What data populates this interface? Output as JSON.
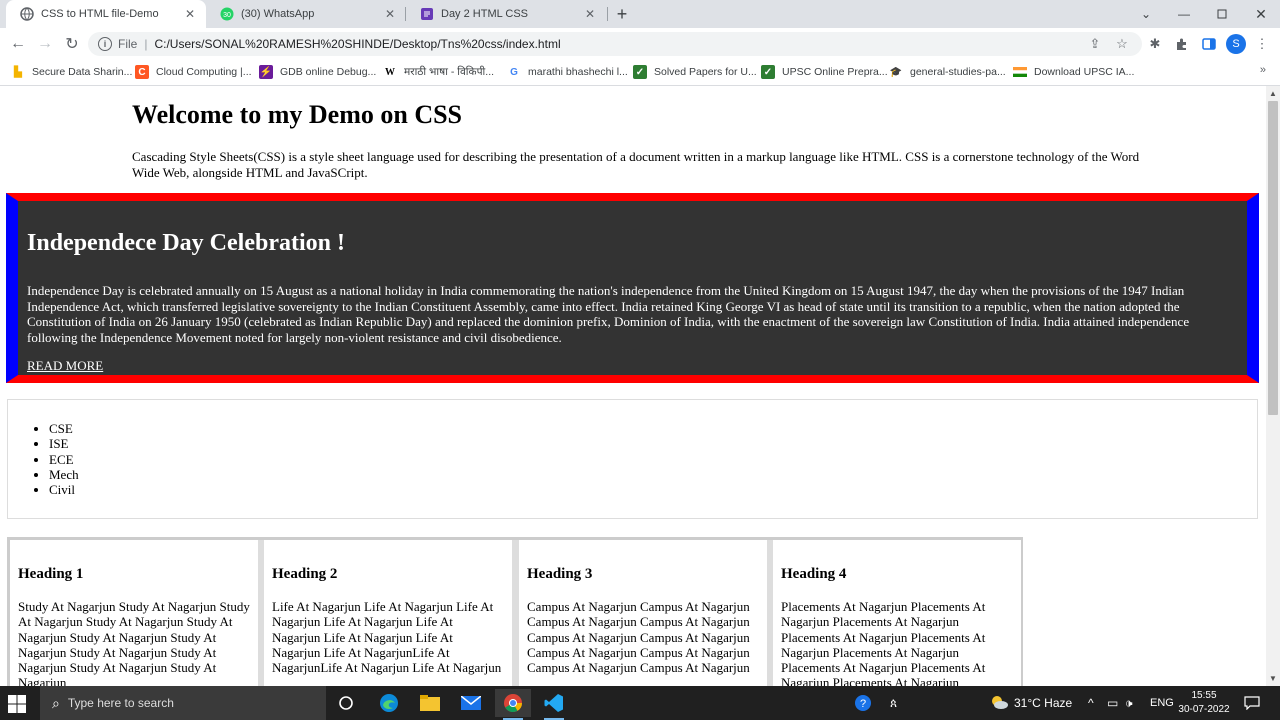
{
  "browser": {
    "tabs": [
      {
        "label": "CSS to HTML file-Demo",
        "icon": "globe-icon",
        "active": true
      },
      {
        "label": "(30) WhatsApp",
        "icon": "whatsapp-icon",
        "active": false
      },
      {
        "label": "Day 2 HTML CSS",
        "icon": "doc-icon",
        "active": false
      }
    ],
    "address": {
      "scheme": "File",
      "url": "C:/Users/SONAL%20RAMESH%20SHINDE/Desktop/Tns%20css/index.html"
    },
    "profile_initial": "S",
    "bookmarks": [
      {
        "label": "Secure Data Sharin...",
        "icon": "secure-data-icon",
        "color": "#f4b400"
      },
      {
        "label": "Cloud Computing |...",
        "icon": "cloud-computing-icon",
        "color": "#ff5722"
      },
      {
        "label": "GDB online Debug...",
        "icon": "gdb-icon",
        "color": "#6a1b9a"
      },
      {
        "label": "मराठी भाषा - विकिपी...",
        "icon": "wikipedia-icon",
        "color": "#000000"
      },
      {
        "label": "marathi bhashechi l...",
        "icon": "google-icon",
        "color": "#4285f4"
      },
      {
        "label": "Solved Papers for U...",
        "icon": "solved-papers-icon",
        "color": "#2e7d32"
      },
      {
        "label": "UPSC Online Prepra...",
        "icon": "upsc-icon",
        "color": "#2e7d32"
      },
      {
        "label": "general-studies-pa...",
        "icon": "graduation-cap-icon",
        "color": "#1a237e"
      },
      {
        "label": "Download UPSC IA...",
        "icon": "india-flag-icon",
        "color": "#ff9933"
      }
    ],
    "bookmarks_more": "»"
  },
  "page": {
    "title": "Welcome to my Demo on CSS",
    "intro": "Cascading Style Sheets(CSS) is a style sheet language used for describing the presentation of a document written in a markup language like HTML. CSS is a cornerstone technology of the Word Wide Web, alongside HTML and JavaSCript.",
    "banner": {
      "heading": "Independece Day Celebration !",
      "text": "Independence Day is celebrated annually on 15 August as a national holiday in India commemorating the nation's independence from the United Kingdom on 15 August 1947, the day when the provisions of the 1947 Indian Independence Act, which transferred legislative sovereignty to the Indian Constituent Assembly, came into effect. India retained King George VI as head of state until its transition to a republic, when the nation adopted the Constitution of India on 26 January 1950 (celebrated as Indian Republic Day) and replaced the dominion prefix, Dominion of India, with the enactment of the sovereign law Constitution of India. India attained independence following the Independence Movement noted for largely non-violent resistance and civil disobedience.",
      "link": "READ MORE",
      "colors": {
        "background": "#333333",
        "horizontal_border": "#ff0000",
        "vertical_border": "#0000ff"
      }
    },
    "branches": [
      "CSE",
      "ISE",
      "ECE",
      "Mech",
      "Civil"
    ],
    "cards": [
      {
        "heading": "Heading 1",
        "text": "Study At Nagarjun Study At Nagarjun Study At Nagarjun Study At Nagarjun Study At Nagarjun Study At Nagarjun Study At Nagarjun Study At Nagarjun Study At Nagarjun Study At Nagarjun Study At Nagarjun"
      },
      {
        "heading": "Heading 2",
        "text": "Life At Nagarjun Life At Nagarjun Life At Nagarjun Life At Nagarjun Life At Nagarjun Life At Nagarjun Life At Nagarjun Life At NagarjunLife At NagarjunLife At Nagarjun Life At Nagarjun"
      },
      {
        "heading": "Heading 3",
        "text": "Campus At Nagarjun Campus At Nagarjun Campus At Nagarjun Campus At Nagarjun Campus At Nagarjun Campus At Nagarjun Campus At Nagarjun Campus At Nagarjun Campus At Nagarjun Campus At Nagarjun"
      },
      {
        "heading": "Heading 4",
        "text": "Placements At Nagarjun Placements At Nagarjun Placements At Nagarjun Placements At Nagarjun Placements At Nagarjun Placements At Nagarjun Placements At Nagarjun Placements At Nagarjun Placements At Nagarjun"
      }
    ]
  },
  "taskbar": {
    "search_placeholder": "Type here to search",
    "weather": "31°C  Haze",
    "language": "ENG",
    "time": "15:55",
    "date": "30-07-2022"
  }
}
